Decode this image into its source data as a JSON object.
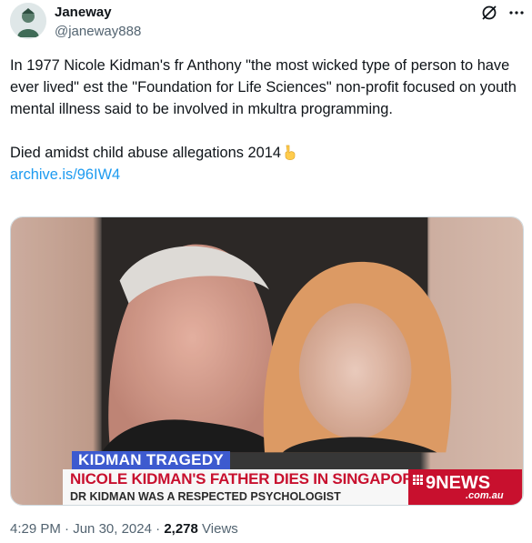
{
  "author": {
    "display_name": "Janeway",
    "handle": "@janeway888"
  },
  "tweet": {
    "paragraph1": "In 1977 Nicole Kidman's fr Anthony \"the most wicked type of person to have ever lived\" est the \"Foundation for Life Sciences\" non-profit focused on youth mental illness said to be involved in mkultra programming.",
    "paragraph2": "Died amidst child abuse allegations 2014",
    "link": "archive.is/96IW4"
  },
  "media": {
    "banner_title": "KIDMAN TRAGEDY",
    "headline": "NICOLE KIDMAN'S FATHER DIES IN SINGAPORE",
    "subheadline": "DR KIDMAN WAS A RESPECTED PSYCHOLOGIST",
    "channel": "9NEWS",
    "channel_site": ".com.au"
  },
  "meta": {
    "time": "4:29 PM",
    "separator": "·",
    "date": "Jun 30, 2024",
    "views_count": "2,278",
    "views_label": "Views"
  },
  "icons": [
    "avatar",
    "grok-icon",
    "more-icon",
    "pointing-down-emoji"
  ],
  "colors": {
    "link": "#1d9bf0",
    "secondary_text": "#536471",
    "news_red": "#c8102e",
    "news_blue": "#3d5acf"
  }
}
